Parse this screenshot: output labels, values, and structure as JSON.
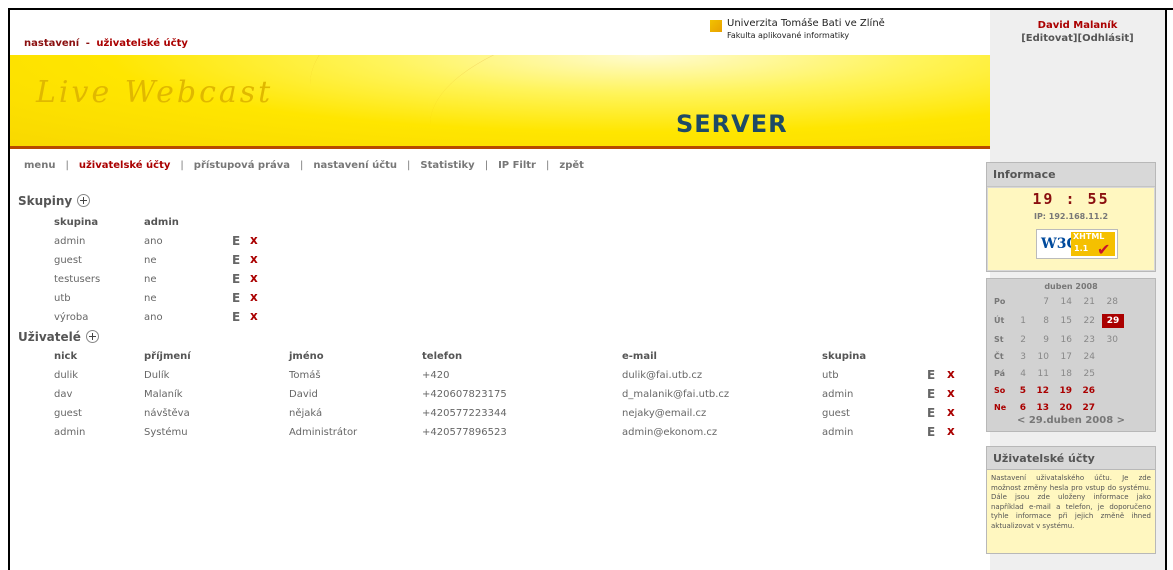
{
  "breadcrumb": {
    "first": "nastavení",
    "sep": "-",
    "current": "uživatelské účty"
  },
  "university": {
    "name": "Univerzita Tomáše Bati ve Zlíně",
    "faculty": "Fakulta aplikované informatiky"
  },
  "banner": {
    "title": "Live Webcast",
    "subtitle": "SERVER"
  },
  "nav": [
    {
      "label": "menu",
      "active": false
    },
    {
      "label": "uživatelské účty",
      "active": true
    },
    {
      "label": "přístupová práva",
      "active": false
    },
    {
      "label": "nastavení účtu",
      "active": false
    },
    {
      "label": "Statistiky",
      "active": false
    },
    {
      "label": "IP Filtr",
      "active": false
    },
    {
      "label": "zpět",
      "active": false
    }
  ],
  "nav_sep": "|",
  "groups": {
    "title": "Skupiny",
    "columns": [
      "skupina",
      "admin"
    ],
    "rows": [
      [
        "admin",
        "ano"
      ],
      [
        "guest",
        "ne"
      ],
      [
        "testusers",
        "ne"
      ],
      [
        "utb",
        "ne"
      ],
      [
        "výroba",
        "ano"
      ]
    ]
  },
  "users": {
    "title": "Uživatelé",
    "columns": [
      "nick",
      "příjmení",
      "jméno",
      "telefon",
      "e-mail",
      "skupina"
    ],
    "rows": [
      [
        "dulik",
        "Dulík",
        "Tomáš",
        "+420",
        "dulik@fai.utb.cz",
        "utb"
      ],
      [
        "dav",
        "Malaník",
        "David",
        "+420607823175",
        "d_malanik@fai.utb.cz",
        "admin"
      ],
      [
        "guest",
        "návštěva",
        "nějaká",
        "+420577223344",
        "nejaky@email.cz",
        "guest"
      ],
      [
        "admin",
        "Systému",
        "Administrátor",
        "+420577896523",
        "admin@ekonom.cz",
        "admin"
      ]
    ]
  },
  "actions": {
    "edit": "E",
    "delete": "x"
  },
  "user": {
    "name": "David Malaník",
    "edit": "[Editovat]",
    "logout": "[Odhlásit]"
  },
  "info": {
    "title": "Informace",
    "time": "19 : 55",
    "ip": "IP: 192.168.11.2",
    "badge_w3c": "W3C",
    "badge_xhtml": "XHTML",
    "badge_version": "1.1"
  },
  "calendar": {
    "title": "duben 2008",
    "days": [
      "Po",
      "Út",
      "St",
      "Čt",
      "Pá",
      "So",
      "Ne"
    ],
    "weeks": [
      [
        "",
        "1",
        "2",
        "3",
        "4",
        "5",
        "6"
      ],
      [
        "7",
        "8",
        "9",
        "10",
        "11",
        "12",
        "13"
      ],
      [
        "14",
        "15",
        "16",
        "17",
        "18",
        "19",
        "20"
      ],
      [
        "21",
        "22",
        "23",
        "24",
        "25",
        "26",
        "27"
      ],
      [
        "28",
        "29",
        "30",
        "",
        "",
        "",
        ""
      ]
    ],
    "today": "29",
    "footer": "< 29.duben 2008 >"
  },
  "accounts_panel": {
    "title": "Uživatelské účty",
    "text": "Nastavení uživatalského účtu. Je zde možnost změny hesla pro vstup do systému. Dále jsou zde uloženy informace jako například e-mail a telefon, je doporučeno tyhle informace při jejich změně ihned aktualizovat v systému."
  },
  "colors": {
    "accent": "#aa0000",
    "banner": "#ffe600",
    "server_text": "#1e4a66"
  }
}
